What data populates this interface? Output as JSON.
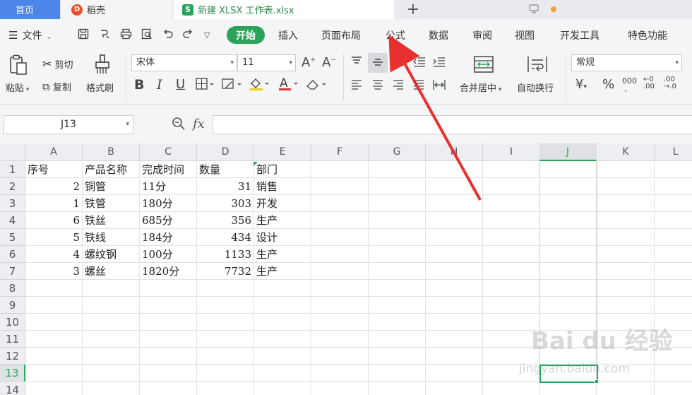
{
  "tabs": {
    "home": "首页",
    "daoke": "稻壳",
    "doc": "新建 XLSX 工作表.xlsx",
    "doc_logo": "S",
    "daoke_logo": "D",
    "plus": "+"
  },
  "menubar": {
    "file": "文件",
    "start": "开始",
    "items": [
      "插入",
      "页面布局",
      "公式",
      "数据",
      "审阅",
      "视图",
      "开发工具",
      "特色功能"
    ]
  },
  "ribbon": {
    "paste": "粘贴",
    "cut": "剪切",
    "copy": "复制",
    "format_painter": "格式刷",
    "font_name": "宋体",
    "font_size": "11",
    "merge_center": "合并居中",
    "wrap_text": "自动换行",
    "number_format": "常规",
    "bold": "B",
    "italic": "I",
    "underline": "U",
    "font_color_letter": "A"
  },
  "formula_bar": {
    "name_box": "J13",
    "fx": "fx",
    "value": ""
  },
  "grid": {
    "columns": [
      "A",
      "B",
      "C",
      "D",
      "E",
      "F",
      "G",
      "H",
      "I",
      "J",
      "K",
      "L"
    ],
    "rows": [
      "1",
      "2",
      "3",
      "4",
      "5",
      "6",
      "7",
      "8",
      "9",
      "10",
      "11",
      "12",
      "13",
      "14"
    ],
    "cells": [
      [
        "序号",
        "产品名称",
        "完成时间",
        "数量",
        "部门"
      ],
      [
        "2",
        "铜管",
        "11分",
        "31",
        "销售"
      ],
      [
        "1",
        "铁管",
        "180分",
        "303",
        "开发"
      ],
      [
        "6",
        "铁丝",
        "685分",
        "356",
        "生产"
      ],
      [
        "5",
        "铁线",
        "184分",
        "434",
        "设计"
      ],
      [
        "4",
        "螺纹钢",
        "100分",
        "1133",
        "生产"
      ],
      [
        "3",
        "螺丝",
        "1820分",
        "7732",
        "生产"
      ]
    ],
    "selected_column": "J",
    "selected_row": "13"
  },
  "watermark": {
    "brand": "Bai du 经验",
    "url": "jingyan.baidu.com"
  },
  "colors": {
    "accent_green": "#2ba358",
    "home_tab_blue": "#4c86e8",
    "arrow_red": "#e8312f"
  }
}
